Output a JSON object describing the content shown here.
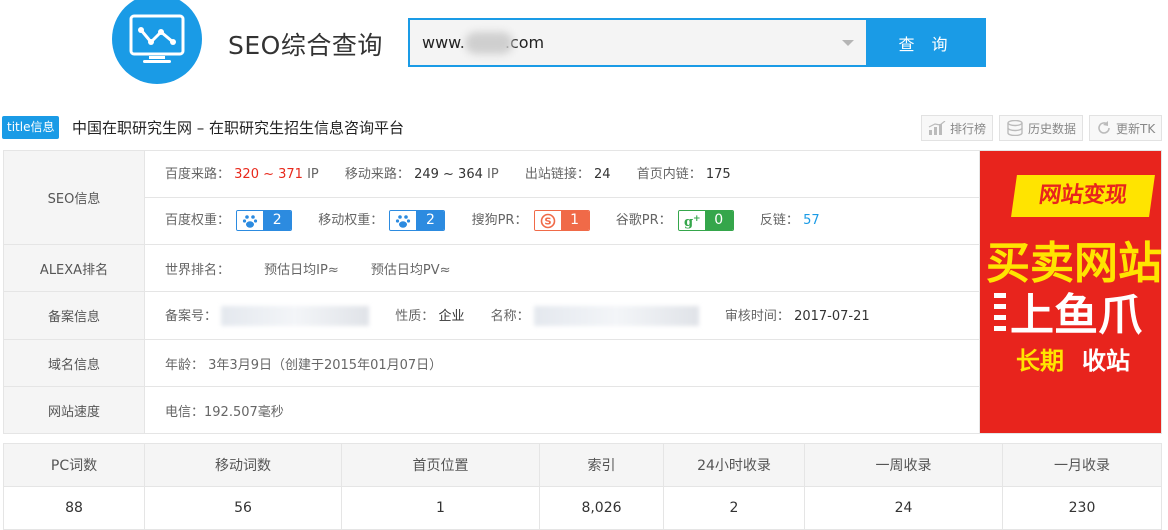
{
  "header": {
    "site_title": "SEO综合查询",
    "search_value_prefix": "www.",
    "search_value_suffix": ".com",
    "search_button": "查 询"
  },
  "title_row": {
    "badge": "title信息",
    "title": "中国在职研究生网 – 在职研究生招生信息咨询平台",
    "tools": [
      "排行榜",
      "历史数据",
      "更新TK"
    ]
  },
  "seo_info": {
    "label": "SEO信息",
    "baidu_traffic_label": "百度来路：",
    "baidu_traffic_value": "320 ~ 371",
    "baidu_traffic_unit": "IP",
    "mobile_traffic_label": "移动来路：",
    "mobile_traffic_value": "249 ~ 364",
    "mobile_traffic_unit": "IP",
    "outbound_label": "出站链接：",
    "outbound_value": "24",
    "internal_label": "首页内链：",
    "internal_value": "175",
    "baidu_weight_label": "百度权重：",
    "baidu_weight_value": "2",
    "mobile_weight_label": "移动权重：",
    "mobile_weight_value": "2",
    "sogou_label": "搜狗PR：",
    "sogou_value": "1",
    "google_label": "谷歌PR：",
    "google_value": "0",
    "backlinks_label": "反链：",
    "backlinks_value": "57"
  },
  "alexa": {
    "label": "ALEXA排名",
    "world_rank_label": "世界排名：",
    "est_ip_label": "预估日均IP≈",
    "est_pv_label": "预估日均PV≈"
  },
  "icp": {
    "label": "备案信息",
    "number_label": "备案号：",
    "nature_label": "性质：",
    "nature_value": "企业",
    "name_label": "名称：",
    "audit_label": "审核时间：",
    "audit_value": "2017-07-21"
  },
  "domain": {
    "label": "域名信息",
    "age_label": "年龄：",
    "age_value": "3年3月9日",
    "created": "（创建于2015年01月07日）"
  },
  "speed": {
    "label": "网站速度",
    "value": "电信：192.507毫秒"
  },
  "ad": {
    "top": "网站变现",
    "mid": "买卖网站",
    "big": "上鱼爪",
    "bottom_left": "长期",
    "bottom_right": "收站"
  },
  "stats": {
    "headers": [
      "PC词数",
      "移动词数",
      "首页位置",
      "索引",
      "24小时收录",
      "一周收录",
      "一月收录"
    ],
    "values": [
      "88",
      "56",
      "1",
      "8,026",
      "2",
      "24",
      "230"
    ]
  },
  "colors": {
    "accent": "#1a9be6",
    "red": "#e8291c",
    "sogou": "#f06a48",
    "google": "#35a64b"
  }
}
